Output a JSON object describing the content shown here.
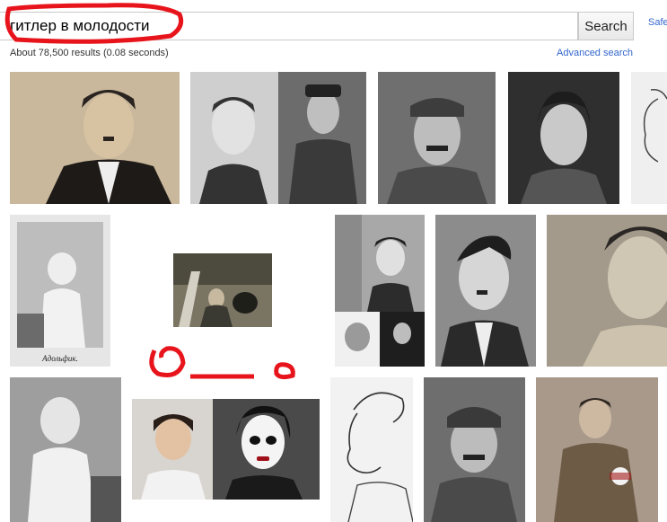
{
  "search": {
    "query": "гитлер в молодости",
    "button_label": "Search",
    "safe_label": "Safe"
  },
  "results": {
    "stats": "About 78,500 results (0.08 seconds)",
    "advanced_label": "Advanced search"
  },
  "thumbnails": [
    {
      "caption": ""
    },
    {
      "caption": ""
    },
    {
      "caption": ""
    },
    {
      "caption": ""
    },
    {
      "caption": ""
    },
    {
      "caption": "Адольфик."
    },
    {
      "caption": ""
    },
    {
      "caption": ""
    },
    {
      "caption": ""
    },
    {
      "caption": ""
    },
    {
      "caption": ""
    },
    {
      "caption": ""
    },
    {
      "caption": ""
    },
    {
      "caption": ""
    },
    {
      "caption": ""
    }
  ],
  "colors": {
    "annotation_red": "#e8141c",
    "link_blue": "#3366cc"
  }
}
